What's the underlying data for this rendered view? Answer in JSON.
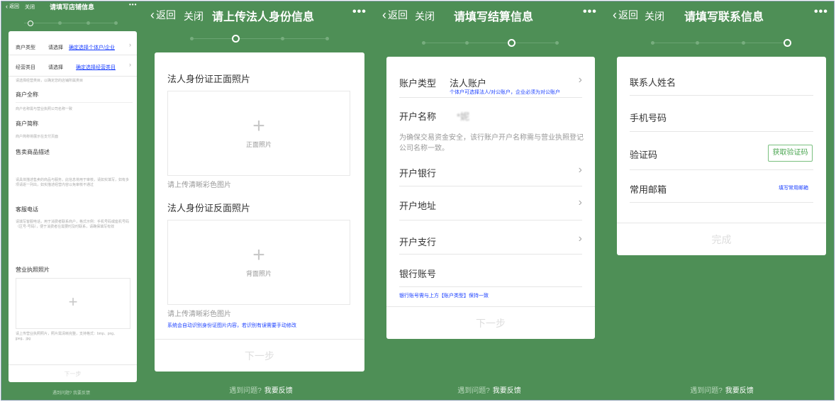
{
  "common": {
    "back": "返回",
    "close": "关闭",
    "more": "•••",
    "chevron": "‹",
    "arrow": "›",
    "plus": "+",
    "footer_q": "遇到问题?",
    "footer_link": "我要反馈",
    "next": "下一步"
  },
  "p1": {
    "title": "请填写店铺信息",
    "merchant_type_label": "商户类型",
    "merchant_type_value": "请选择",
    "merchant_type_link": "确定选择个体户/企业",
    "business_label": "经营类目",
    "business_value": "请选择",
    "business_link": "确定选择经营类目",
    "business_hint": "请选择经营类目，以确定您的店铺所属类目",
    "fullname_label": "商户全称",
    "fullname_hint": "商户名称需与营业执照公司名称一致",
    "short_label": "商户简称",
    "short_hint": "商户简称将展示在支付页面",
    "goods_label": "售卖商品描述",
    "goods_hint": "请具体描述售卖的商品与服务，此信息将用于审核，请如实填写，如有多项请逐一列出，如实描述经营内容以免审核不通过",
    "phone_label": "客服电话",
    "phone_hint": "请填写客服电话，用于消费者联系商户，格式示例：手机号码或座机号码（区号-号码），便于消费者在需要时及时联系，请确保填写有效",
    "license_label": "营业执照照片",
    "license_hint": "请上传营业执照照片，照片需清晰完整，支持格式：bmp、png、jpeg、jpg",
    "next": "下一步",
    "footer": "遇到问题? 我要反馈"
  },
  "p2": {
    "title": "请上传法人身份信息",
    "front_title": "法人身份证正面照片",
    "front_box": "正面照片",
    "front_hint": "请上传清晰彩色图片",
    "back_title": "法人身份证反面照片",
    "back_box": "背面照片",
    "back_hint": "请上传清晰彩色图片",
    "blue_hint": "系统会自动识别身份证图片内容，若识别有误需要手动修改",
    "next": "下一步"
  },
  "p3": {
    "title": "请填写结算信息",
    "account_type_label": "账户类型",
    "account_type_value": "法人账户",
    "account_type_hint": "个体户可选择法人/对公账户，企业必须为对公账户",
    "account_name_label": "开户名称",
    "account_name_value": "*妮",
    "account_name_hint": "为确保交易资金安全，该行账户开户名称需与营业执照登记公司名称一致。",
    "bank_label": "开户银行",
    "address_label": "开户地址",
    "branch_label": "开户支行",
    "account_no_label": "银行账号",
    "account_no_hint": "银行账号需与上方【账户类型】保持一致",
    "next": "下一步"
  },
  "p4": {
    "title": "请填写联系信息",
    "name_label": "联系人姓名",
    "phone_label": "手机号码",
    "code_label": "验证码",
    "code_button": "获取验证码",
    "email_label": "常用邮箱",
    "email_link": "填写常用邮箱",
    "done": "完成"
  },
  "colors": {
    "background": "#4e8f56",
    "card": "#ffffff",
    "link": "#1a3fff",
    "accent_green": "#4aa550"
  }
}
